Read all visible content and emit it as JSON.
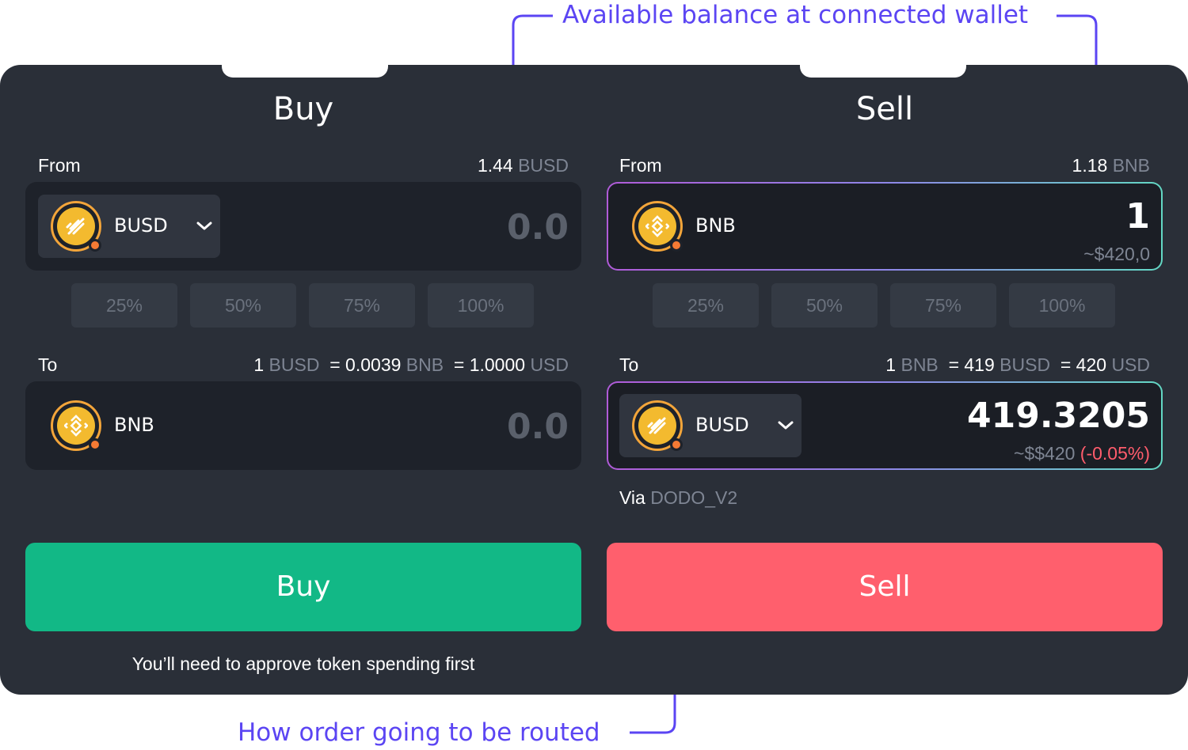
{
  "annotations": {
    "balance": "Available balance at connected wallet",
    "routing": "How order going to be routed"
  },
  "colors": {
    "annotation": "#5b45f3",
    "buy_accent": "#12b886",
    "sell_accent": "#ff5f6d",
    "panel_bg": "#2a2f38"
  },
  "buy": {
    "title": "Buy",
    "from_label": "From",
    "from_balance": "1.44",
    "from_balance_unit": "BUSD",
    "from_token": "BUSD",
    "from_token_icon": "chevron-down-icon",
    "from_amount_placeholder": "0.0",
    "percent_buttons": [
      "25%",
      "50%",
      "75%",
      "100%"
    ],
    "to_label": "To",
    "rate": {
      "base": "1",
      "base_unit": "BUSD",
      "quote": "= 0.0039",
      "quote_unit": "BNB",
      "usd": "= 1.0000",
      "usd_unit": "USD"
    },
    "to_token": "BNB",
    "to_amount_placeholder": "0.0",
    "action_label": "Buy",
    "note": "You’ll need to approve token spending first"
  },
  "sell": {
    "title": "Sell",
    "from_label": "From",
    "from_balance": "1.18",
    "from_balance_unit": "BNB",
    "from_token": "BNB",
    "from_amount": "1",
    "from_amount_usd": "~$420,0",
    "percent_buttons": [
      "25%",
      "50%",
      "75%",
      "100%"
    ],
    "to_label": "To",
    "rate": {
      "base": "1",
      "base_unit": "BNB",
      "quote": "= 419",
      "quote_unit": "BUSD",
      "usd": "= 420",
      "usd_unit": "USD"
    },
    "to_token": "BUSD",
    "to_amount": "419.3205",
    "to_amount_usd": "~$$420",
    "to_amount_change": "(-0.05%)",
    "via_label": "Via",
    "via_value": "DODO_V2",
    "action_label": "Sell"
  }
}
